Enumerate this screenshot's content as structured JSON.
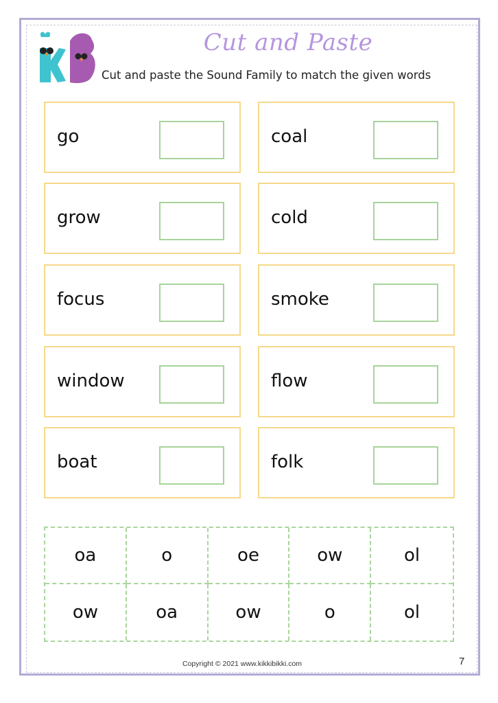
{
  "header": {
    "title": "Cut and Paste",
    "subtitle": "Cut and paste the Sound Family to match the given words",
    "logo": {
      "icon": "kikkibikki-logo-icon",
      "letters": "KB",
      "colors": {
        "k": "#3ec3cf",
        "b": "#a65bb0"
      }
    }
  },
  "words": {
    "left": [
      "go",
      "grow",
      "focus",
      "window",
      "boat"
    ],
    "right": [
      "coal",
      "cold",
      "smoke",
      "flow",
      "folk"
    ]
  },
  "cutouts": {
    "row1": [
      "oa",
      "o",
      "oe",
      "ow",
      "ol"
    ],
    "row2": [
      "ow",
      "oa",
      "ow",
      "o",
      "ol"
    ]
  },
  "footer": {
    "copyright": "Copyright © 2021 www.kikkibikki.com",
    "page_number": "7"
  },
  "colors": {
    "frame": "#b3a9d6",
    "card_border": "#f5d98a",
    "slot_border": "#a6d49a",
    "cut_border": "#a9d69c",
    "title": "#b596dd"
  }
}
